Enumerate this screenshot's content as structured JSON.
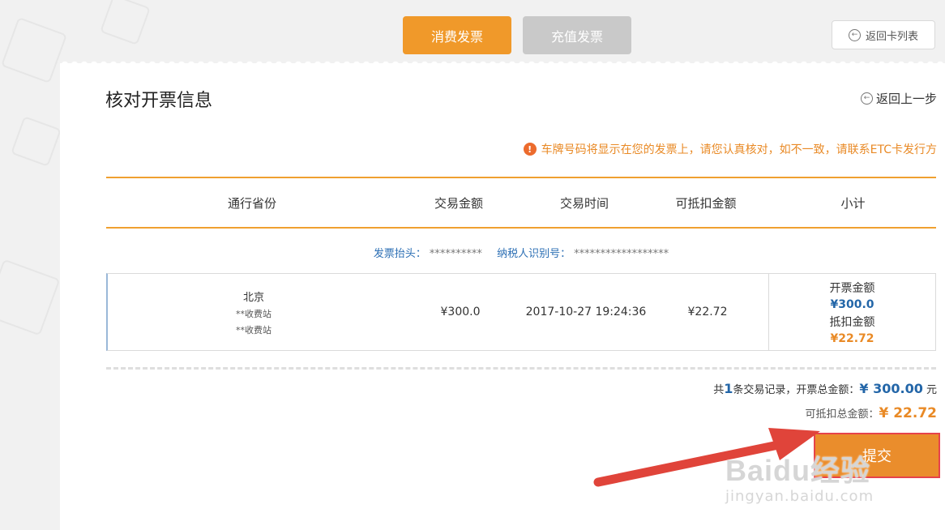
{
  "tabs": [
    {
      "label": "消费发票",
      "active": true
    },
    {
      "label": "充值发票",
      "active": false
    }
  ],
  "back_to_list": {
    "label": "返回卡列表",
    "icon": "back-arrow-circle-icon"
  },
  "page": {
    "title": "核对开票信息",
    "back_prev": {
      "label": "返回上一步",
      "icon": "back-arrow-circle-icon"
    },
    "notice": {
      "icon": "warning-icon",
      "text": "车牌号码将显示在您的发票上，请您认真核对，如不一致，请联系ETC卡发行方"
    }
  },
  "table": {
    "headers": [
      "通行省份",
      "交易金额",
      "交易时间",
      "可抵扣金额",
      "小计"
    ],
    "invoice_head": {
      "label": "发票抬头：",
      "value": "**********",
      "tax_label": "纳税人识别号：",
      "tax_value": "******************"
    },
    "row": {
      "province": "北京",
      "station1": "**收费站",
      "station2": "**收费站",
      "amount": "¥300.0",
      "time": "2017-10-27 19:24:36",
      "deductible": "¥22.72",
      "subtotal": {
        "invoice_label": "开票金额",
        "invoice_value": "¥300.0",
        "deduct_label": "抵扣金额",
        "deduct_value": "¥22.72"
      }
    }
  },
  "summary": {
    "prefix": "共",
    "count": "1",
    "middle": "条交易记录，开票总金额：",
    "total": "¥ 300.00",
    "unit": "元",
    "deduct_label": "可抵扣总金额：",
    "deduct_total": "¥ 22.72"
  },
  "submit": {
    "label": "提交"
  },
  "watermark": {
    "logo": "Baidu经验",
    "url": "jingyan.baidu.com"
  },
  "colors": {
    "accent": "#f0992a",
    "inactive_tab": "#c9c9c9",
    "blue_value": "#2366a8",
    "arrow": "#e0443a",
    "submit_border": "#e6434b"
  }
}
